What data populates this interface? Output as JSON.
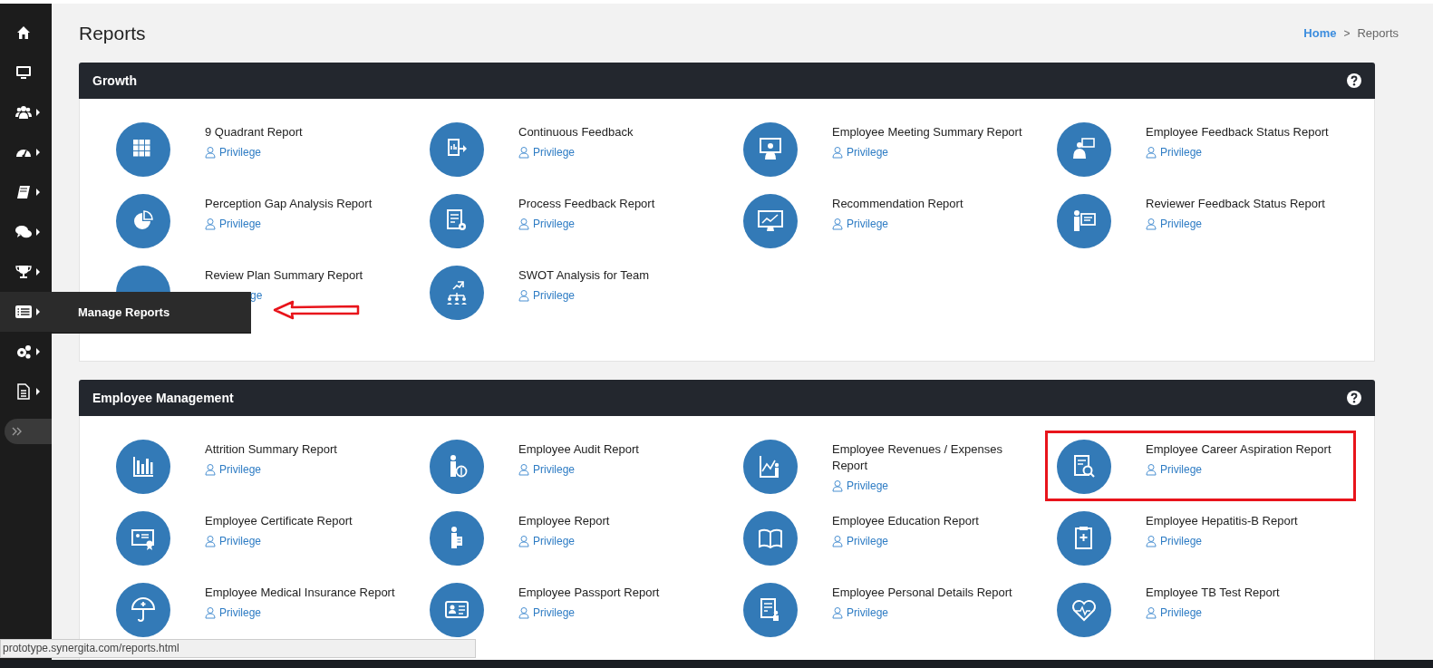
{
  "sidebar": {
    "items": [
      {
        "caret": false,
        "selected": false
      },
      {
        "caret": false,
        "selected": false
      },
      {
        "caret": true,
        "selected": false
      },
      {
        "caret": true,
        "selected": false
      },
      {
        "caret": true,
        "selected": false
      },
      {
        "caret": true,
        "selected": false
      },
      {
        "caret": true,
        "selected": false
      },
      {
        "caret": true,
        "selected": true,
        "flyout": "Manage Reports"
      },
      {
        "caret": true,
        "selected": false
      },
      {
        "caret": true,
        "selected": false
      }
    ]
  },
  "page": {
    "title": "Reports",
    "breadcrumb": {
      "home": "Home",
      "separator": ">",
      "current": "Reports"
    }
  },
  "sections": [
    {
      "title": "Growth",
      "items": [
        {
          "title": "9 Quadrant Report",
          "link": "Privilege",
          "highlighted": false
        },
        {
          "title": "Continuous Feedback",
          "link": "Privilege",
          "highlighted": false
        },
        {
          "title": "Employee Meeting Summary Report",
          "link": "Privilege",
          "highlighted": false
        },
        {
          "title": "Employee Feedback Status Report",
          "link": "Privilege",
          "highlighted": false
        },
        {
          "title": "Perception Gap Analysis Report",
          "link": "Privilege",
          "highlighted": false
        },
        {
          "title": "Process Feedback Report",
          "link": "Privilege",
          "highlighted": false
        },
        {
          "title": "Recommendation Report",
          "link": "Privilege",
          "highlighted": false
        },
        {
          "title": "Reviewer Feedback Status Report",
          "link": "Privilege",
          "highlighted": false
        },
        {
          "title": "Review Plan Summary Report",
          "link": "ge",
          "highlighted": false,
          "kind": "partly_covered"
        },
        {
          "title": "SWOT Analysis for Team",
          "link": "Privilege",
          "highlighted": false
        }
      ]
    },
    {
      "title": "Employee Management",
      "items": [
        {
          "title": "Attrition Summary Report",
          "link": "Privilege",
          "highlighted": false
        },
        {
          "title": "Employee Audit Report",
          "link": "Privilege",
          "highlighted": false
        },
        {
          "title": "Employee Revenues / Expenses Report",
          "link": "Privilege",
          "highlighted": false
        },
        {
          "title": "Employee Career Aspiration Report",
          "link": "Privilege",
          "highlighted": true
        },
        {
          "title": "Employee Certificate Report",
          "link": "Privilege",
          "highlighted": false
        },
        {
          "title": "Employee Report",
          "link": "Privilege",
          "highlighted": false
        },
        {
          "title": "Employee Education Report",
          "link": "Privilege",
          "highlighted": false
        },
        {
          "title": "Employee Hepatitis-B Report",
          "link": "Privilege",
          "highlighted": false
        },
        {
          "title": "Employee Medical Insurance Report",
          "link": "Privilege",
          "highlighted": false
        },
        {
          "title": "Employee Passport Report",
          "link": "Privilege",
          "highlighted": false
        },
        {
          "title": "Employee Personal Details Report",
          "link": "Privilege",
          "highlighted": false
        },
        {
          "title": "Employee TB Test Report",
          "link": "Privilege",
          "highlighted": false
        }
      ]
    }
  ],
  "status_bar": {
    "url": "prototype.synergita.com/reports.html"
  }
}
